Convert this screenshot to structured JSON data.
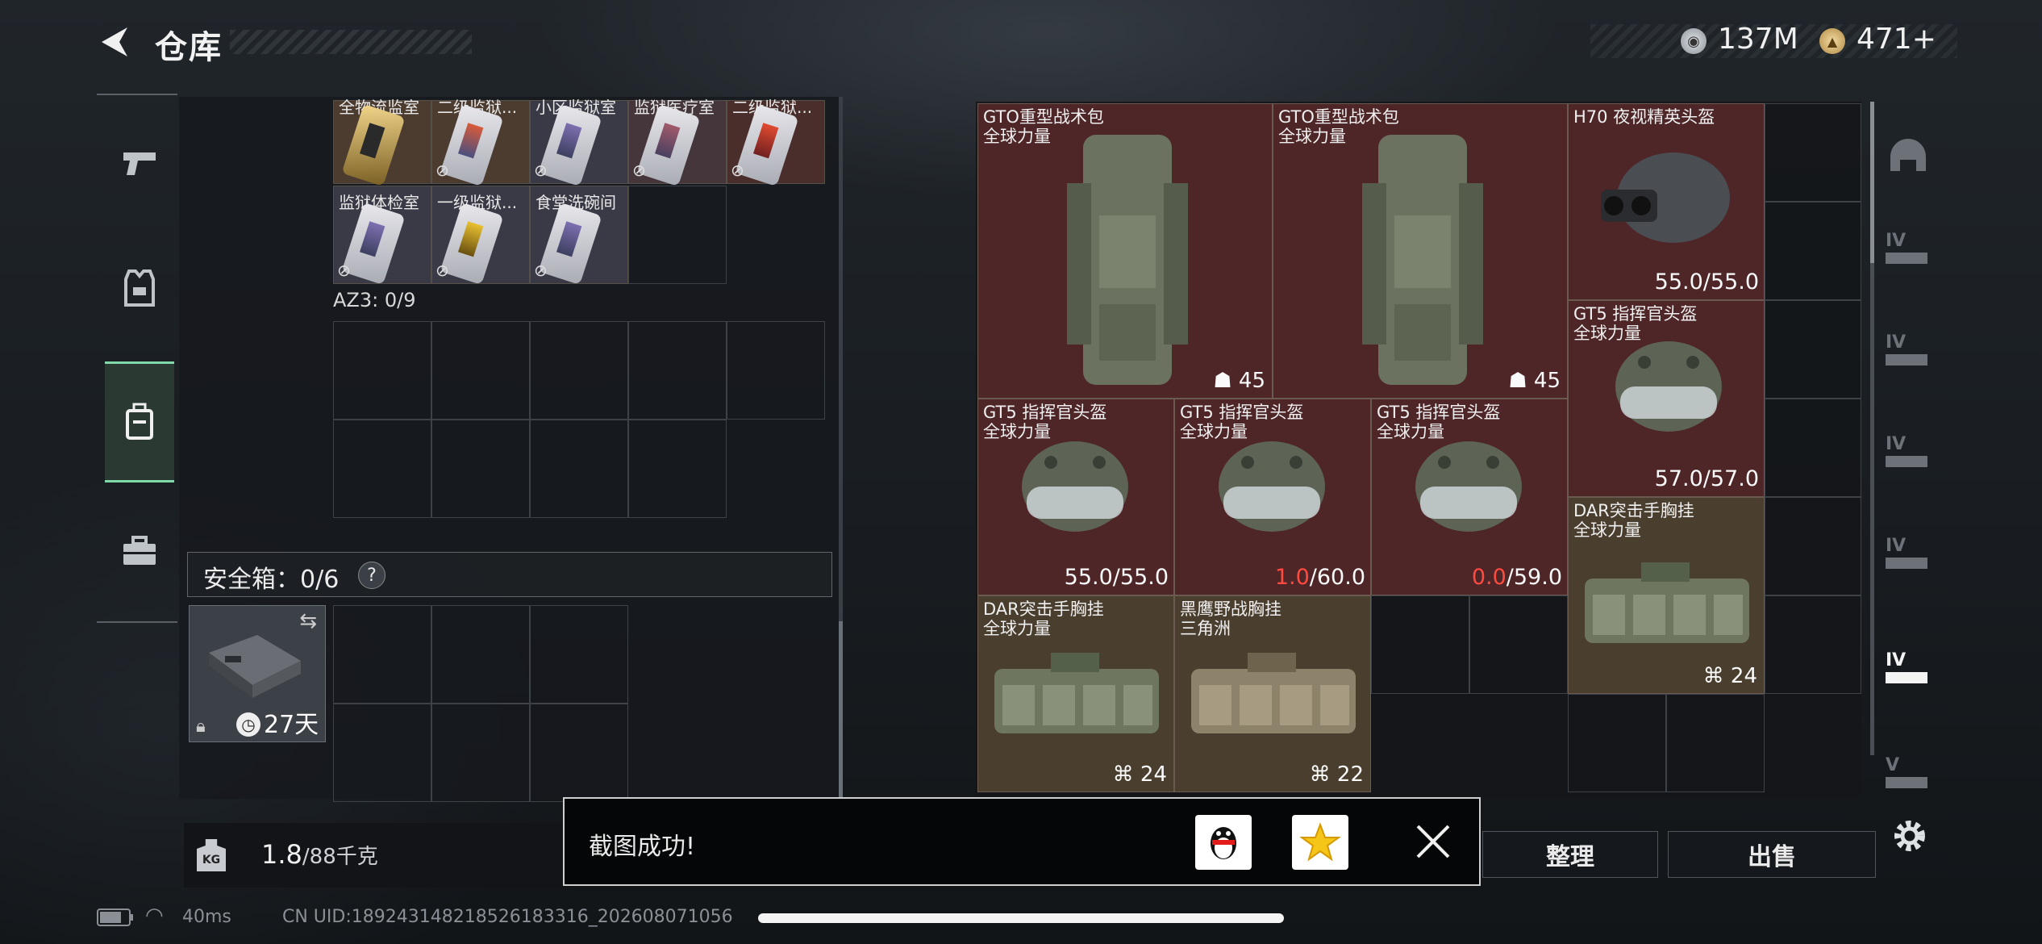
{
  "header": {
    "title": "仓库",
    "currency": [
      {
        "icon": "silver-coin-icon",
        "value": "137M"
      },
      {
        "icon": "gold-coin-icon",
        "value": "471+"
      }
    ]
  },
  "left_nav": [
    {
      "icon": "pistol-icon",
      "active": false
    },
    {
      "icon": "armor-vest-icon",
      "active": false
    },
    {
      "icon": "backpack-icon",
      "active": true
    },
    {
      "icon": "toolbox-icon",
      "active": false
    }
  ],
  "keycards": {
    "row1": [
      "全物流监室",
      "二级监狱...",
      "小区监狱室",
      "监狱医疗室",
      "二级监狱..."
    ],
    "row2": [
      "监狱体检室",
      "一级监狱...",
      "食堂洗碗间"
    ]
  },
  "az3_label": "AZ3: 0/9",
  "safe": {
    "label": "安全箱：0/6",
    "help": "?",
    "days": "27天"
  },
  "weight": {
    "current": "1.8",
    "max": "/88千克",
    "icon_text": "KG"
  },
  "items": [
    {
      "id": "gto1",
      "name": "GTO重型战术包",
      "region": "全球力量",
      "cap": "45"
    },
    {
      "id": "gto2",
      "name": "GTO重型战术包",
      "region": "全球力量",
      "cap": "45"
    },
    {
      "id": "h70",
      "name": "H70 夜视精英头盔",
      "region": "",
      "dur_a": "55.0",
      "dur_b": "/55.0"
    },
    {
      "id": "gt5a",
      "name": "GT5 指挥官头盔",
      "region": "全球力量",
      "dur_a": "57.0",
      "dur_b": "/57.0"
    },
    {
      "id": "gt5b",
      "name": "GT5 指挥官头盔",
      "region": "全球力量",
      "dur_a": "55.0",
      "dur_b": "/55.0"
    },
    {
      "id": "gt5c",
      "name": "GT5 指挥官头盔",
      "region": "全球力量",
      "dur_a": "1.0",
      "dur_b": "/60.0"
    },
    {
      "id": "gt5d",
      "name": "GT5 指挥官头盔",
      "region": "全球力量",
      "dur_a": "0.0",
      "dur_b": "/59.0"
    },
    {
      "id": "dar1",
      "name": "DAR突击手胸挂",
      "region": "全球力量",
      "cap": "24"
    },
    {
      "id": "dar2",
      "name": "DAR突击手胸挂",
      "region": "全球力量",
      "cap": "24"
    },
    {
      "id": "hy",
      "name": "黑鹰野战胸挂",
      "region": "三角洲",
      "cap": "22"
    }
  ],
  "right_tabs": [
    {
      "label": "",
      "icon": "helmet-tab-icon"
    },
    {
      "label": "IV",
      "icon": "tier-iv-icon"
    },
    {
      "label": "IV",
      "icon": "tier-iv-icon"
    },
    {
      "label": "IV",
      "icon": "tier-iv-icon"
    },
    {
      "label": "IV",
      "icon": "tier-iv-icon"
    },
    {
      "label": "IV",
      "icon": "tier-iv-icon"
    },
    {
      "label": "V",
      "icon": "tier-v-icon"
    }
  ],
  "buttons": {
    "sort": "整理",
    "sell": "出售"
  },
  "toast": {
    "text": "截图成功!"
  },
  "status": {
    "ping": "40ms",
    "uid": "CN UID:18924314821852618331​6_202608071056"
  },
  "colors": {
    "accent": "#7fd9a8",
    "red_value": "#ff4a40"
  }
}
